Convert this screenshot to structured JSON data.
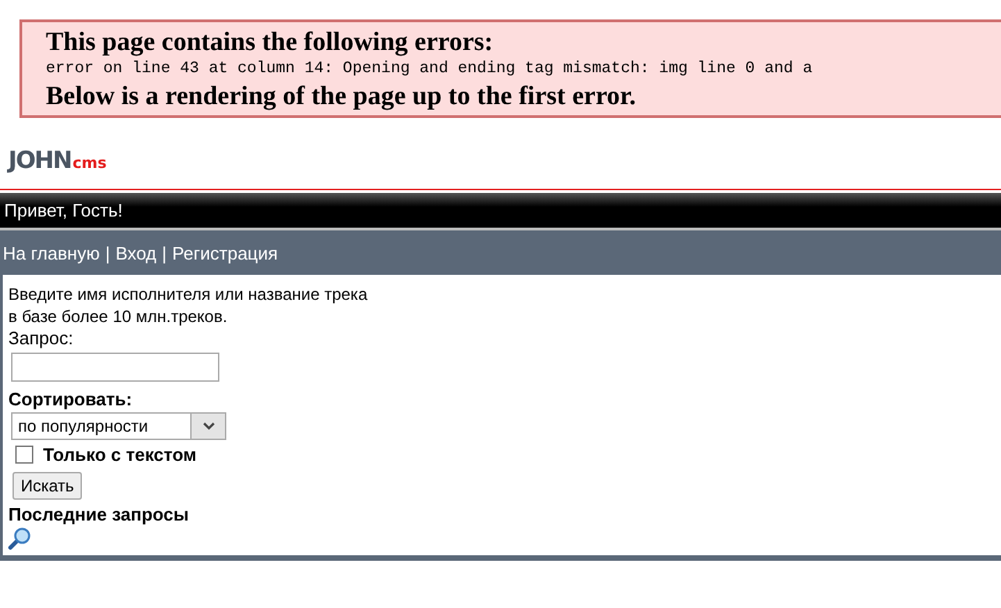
{
  "error_box": {
    "title": "This page contains the following errors:",
    "message": "error on line 43 at column 14: Opening and ending tag mismatch: img line 0 and a",
    "footer": "Below is a rendering of the page up to the first error."
  },
  "logo": {
    "main": "JOHN",
    "accent": "cms"
  },
  "header": {
    "greeting": "Привет, Гость!"
  },
  "nav": [
    {
      "label": "На главную"
    },
    {
      "label": "Вход"
    },
    {
      "label": "Регистрация"
    }
  ],
  "nav_separator": "|",
  "form": {
    "intro_lines": [
      "Введите имя исполнителя или название трека",
      "в базе более 10 млн.треков."
    ],
    "query_label": "Запрос:",
    "sort_label": "Сортировать:",
    "sort_value": "по популярности",
    "text_only": {
      "label": "Только с текстом",
      "checked": false
    },
    "submit": "Искать",
    "recent_label": "Последние запросы"
  }
}
